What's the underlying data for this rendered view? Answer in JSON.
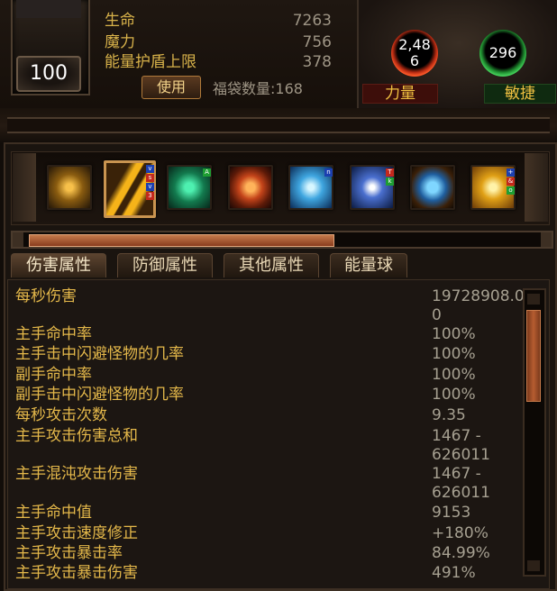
{
  "character": {
    "level": "100",
    "stats": [
      {
        "label": "生命",
        "value": "7263"
      },
      {
        "label": "魔力",
        "value": "756"
      },
      {
        "label": "能量护盾上限",
        "value": "378"
      }
    ],
    "use_button": "使用",
    "bag_count": "福袋数量:168"
  },
  "orbs": {
    "strength_value": "2,48\n6",
    "strength_label": "力量",
    "agility_value": "296",
    "agility_label": "敏捷"
  },
  "skills": [
    {
      "name": "sword-skill-icon",
      "keys": []
    },
    {
      "name": "twin-blades-skill-icon",
      "keys": [
        "v",
        "s",
        "v",
        "3"
      ],
      "selected": true
    },
    {
      "name": "poison-spirit-skill-icon",
      "keys": [
        "A"
      ]
    },
    {
      "name": "fire-ring-skill-icon",
      "keys": []
    },
    {
      "name": "lightning-skill-icon",
      "keys": [
        "n"
      ]
    },
    {
      "name": "frost-rune-skill-icon",
      "keys": [
        "T",
        "k"
      ]
    },
    {
      "name": "water-orb-skill-icon",
      "keys": []
    },
    {
      "name": "golden-cross-skill-icon",
      "keys": [
        "+",
        "&",
        "o"
      ]
    }
  ],
  "progress": 0.59,
  "tabs": [
    "伤害属性",
    "防御属性",
    "其他属性",
    "能量球"
  ],
  "attributes": [
    {
      "label": "每秒伤害",
      "value": "19728908.00"
    },
    {
      "label": "主手命中率",
      "value": "100%"
    },
    {
      "label": "主手击中闪避怪物的几率",
      "value": "100%"
    },
    {
      "label": "副手命中率",
      "value": "100%"
    },
    {
      "label": "副手击中闪避怪物的几率",
      "value": "100%"
    },
    {
      "label": "每秒攻击次数",
      "value": "9.35"
    },
    {
      "label": "主手攻击伤害总和",
      "value": "1467 -\n626011"
    },
    {
      "label": "主手混沌攻击伤害",
      "value": "1467 -\n626011"
    },
    {
      "label": "主手命中值",
      "value": "9153"
    },
    {
      "label": "主手攻击速度修正",
      "value": "+180%"
    },
    {
      "label": "主手攻击暴击率",
      "value": "84.99%"
    },
    {
      "label": "主手攻击暴击伤害",
      "value": "491%"
    }
  ],
  "colors": {
    "label": "#e4b84a",
    "value": "#a6a091",
    "accent": "#c99450"
  }
}
